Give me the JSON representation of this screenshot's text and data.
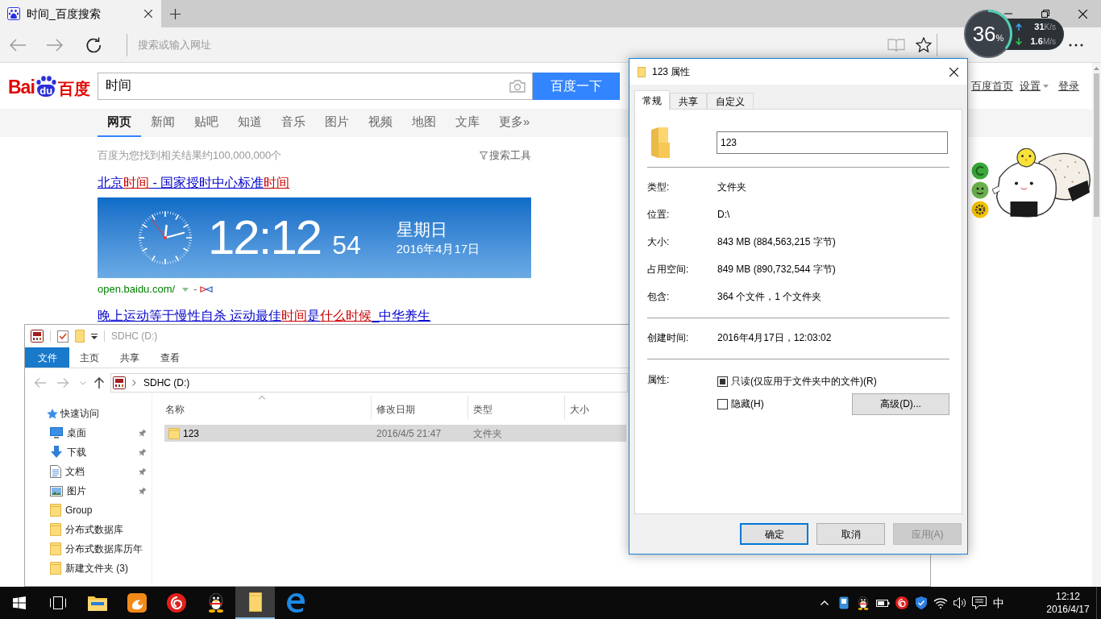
{
  "browser": {
    "tab_title": "时间_百度搜索",
    "address_placeholder": "搜索或输入网址"
  },
  "net_monitor": {
    "load": "36",
    "load_unit": "%",
    "upload": "31",
    "upload_unit": "K/s",
    "download": "1.6",
    "download_unit": "M/s"
  },
  "baidu": {
    "logo": {
      "left": "Bai",
      "paw": "du",
      "right": "百度"
    },
    "search_value": "时间",
    "search_button": "百度一下",
    "top_links": [
      {
        "label": "百度首页",
        "dropdown": false
      },
      {
        "label": "设置",
        "dropdown": true
      },
      {
        "label": "登录",
        "dropdown": false
      }
    ],
    "nav": [
      {
        "label": "网页",
        "selected": true
      },
      {
        "label": "新闻",
        "selected": false
      },
      {
        "label": "贴吧",
        "selected": false
      },
      {
        "label": "知道",
        "selected": false
      },
      {
        "label": "音乐",
        "selected": false
      },
      {
        "label": "图片",
        "selected": false
      },
      {
        "label": "视频",
        "selected": false
      },
      {
        "label": "地图",
        "selected": false
      },
      {
        "label": "文库",
        "selected": false
      },
      {
        "label": "更多»",
        "selected": false
      }
    ],
    "result_count": "百度为您找到相关结果约100,000,000个",
    "search_tools": "搜索工具",
    "results": [
      {
        "kind": "clock",
        "title": [
          {
            "text": "北京",
            "highlight": false
          },
          {
            "text": "时间",
            "highlight": true
          },
          {
            "text": " - 国家授时中心标准",
            "highlight": false
          },
          {
            "text": "时间",
            "highlight": true
          }
        ],
        "clock": {
          "time": "12:12",
          "seconds": "54",
          "weekday": "星期日",
          "date": "2016年4月17日"
        },
        "url": "open.baidu.com/",
        "separator": "-"
      },
      {
        "kind": "plain",
        "title": [
          {
            "text": "晚上运动等于慢性自杀 运动最佳",
            "highlight": false
          },
          {
            "text": "时间",
            "highlight": true
          },
          {
            "text": "是",
            "highlight": false
          },
          {
            "text": "什么时候",
            "highlight": true
          },
          {
            "text": "_中华养生",
            "highlight": false
          }
        ]
      }
    ]
  },
  "explorer": {
    "title": "SDHC (D:)",
    "ribbon": [
      {
        "label": "文件",
        "kind": "menu"
      },
      {
        "label": "主页",
        "kind": "tab"
      },
      {
        "label": "共享",
        "kind": "tab"
      },
      {
        "label": "查看",
        "kind": "tab"
      }
    ],
    "address": "SDHC (D:)",
    "nav": [
      {
        "label": "快速访问",
        "kind": "quick_access",
        "children": [
          {
            "label": "桌面",
            "kind": "desktop",
            "pinned": true
          },
          {
            "label": "下载",
            "kind": "download",
            "pinned": true
          },
          {
            "label": "文档",
            "kind": "document",
            "pinned": true
          },
          {
            "label": "图片",
            "kind": "picture",
            "pinned": true
          },
          {
            "label": "Group",
            "kind": "folder",
            "pinned": false
          },
          {
            "label": "分布式数据库",
            "kind": "folder",
            "pinned": false
          },
          {
            "label": "分布式数据库历年",
            "kind": "folder",
            "pinned": false
          },
          {
            "label": "新建文件夹 (3)",
            "kind": "folder",
            "pinned": false
          }
        ]
      }
    ],
    "columns": [
      {
        "label": "名称",
        "sorted": true
      },
      {
        "label": "修改日期",
        "sorted": false
      },
      {
        "label": "类型",
        "sorted": false
      },
      {
        "label": "大小",
        "sorted": false
      }
    ],
    "rows": [
      {
        "name": "123",
        "modified": "2016/4/5 21:47",
        "type": "文件夹",
        "selected": true
      }
    ]
  },
  "properties_dialog": {
    "title": "123 属性",
    "tabs": [
      {
        "label": "常规",
        "selected": true
      },
      {
        "label": "共享",
        "selected": false
      },
      {
        "label": "自定义",
        "selected": false
      }
    ],
    "name_value": "123",
    "sections": [
      {
        "rows": [
          {
            "label": "类型:",
            "value": "文件夹"
          },
          {
            "label": "位置:",
            "value": "D:\\"
          },
          {
            "label": "大小:",
            "value": "843 MB (884,563,215 字节)"
          },
          {
            "label": "占用空间:",
            "value": "849 MB (890,732,544 字节)"
          },
          {
            "label": "包含:",
            "value": "364 个文件，1 个文件夹"
          }
        ]
      },
      {
        "rows": [
          {
            "label": "创建时间:",
            "value": "2016年4月17日，12:03:02"
          }
        ]
      }
    ],
    "attributes_label": "属性:",
    "attributes": [
      {
        "label": "只读(仅应用于文件夹中的文件)(R)",
        "indeterminate": true
      },
      {
        "label": "隐藏(H)",
        "indeterminate": false
      }
    ],
    "advanced_button": "高级(D)...",
    "buttons": [
      {
        "label": "确定",
        "default": true,
        "disabled": false
      },
      {
        "label": "取消",
        "default": false,
        "disabled": false
      },
      {
        "label": "应用(A)",
        "default": false,
        "disabled": true
      }
    ]
  },
  "taskbar": {
    "apps": [
      {
        "kind": "file_explorer",
        "selected": false
      },
      {
        "kind": "uc_browser",
        "selected": false
      },
      {
        "kind": "music",
        "selected": false
      },
      {
        "kind": "qq",
        "selected": false
      },
      {
        "kind": "folder",
        "selected": true
      },
      {
        "kind": "edge",
        "selected": false
      }
    ],
    "ime": "中",
    "time": "12:12",
    "date": "2016/4/17"
  }
}
